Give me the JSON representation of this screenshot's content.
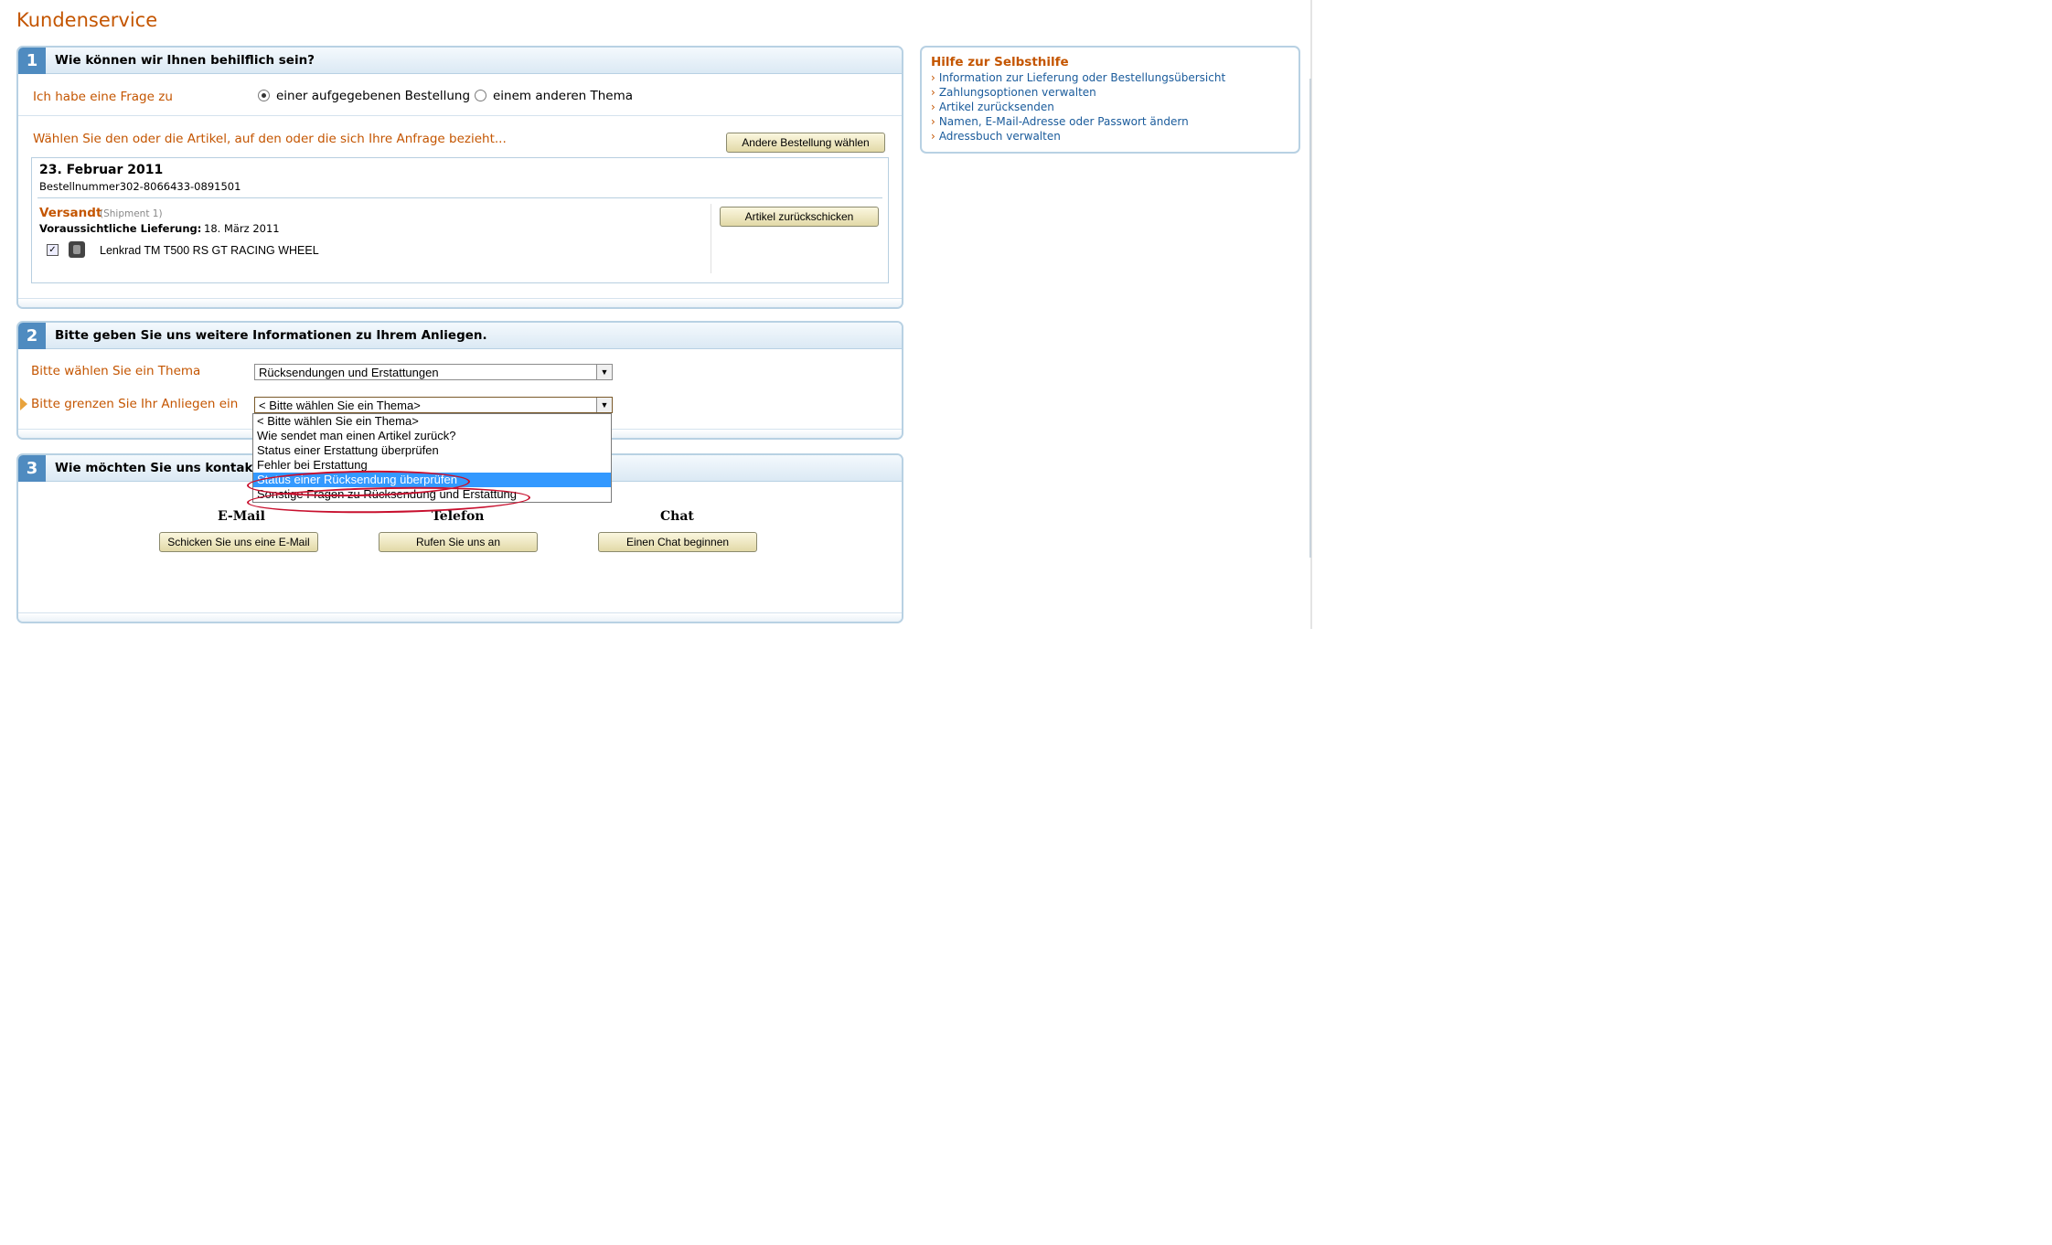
{
  "page_title": "Kundenservice",
  "section1": {
    "number": "1",
    "title": "Wie können wir Ihnen behilflich sein?",
    "question_label": "Ich habe eine Frage zu",
    "radio_order": "einer aufgegebenen Bestellung",
    "radio_other": "einem anderen Thema",
    "select_items_label": "Wählen Sie den oder die Artikel, auf den oder die sich Ihre Anfrage bezieht...",
    "other_order_button": "Andere Bestellung wählen",
    "order": {
      "date": "23. Februar 2011",
      "order_number": "Bestellnummer302-8066433-0891501",
      "shipped": "Versandt",
      "shipment": "(Shipment 1)",
      "delivery_label": "Voraussichtliche Lieferung:",
      "delivery_date": "18. März 2011",
      "item_name": "Lenkrad TM T500 RS GT RACING WHEEL",
      "return_button": "Artikel zurückschicken"
    }
  },
  "section2": {
    "number": "2",
    "title": "Bitte geben Sie uns weitere Informationen zu Ihrem Anliegen.",
    "topic_label": "Bitte wählen Sie ein Thema",
    "topic_value": "Rücksendungen und Erstattungen",
    "narrow_label": "Bitte grenzen Sie Ihr Anliegen ein",
    "narrow_value": "< Bitte wählen Sie ein Thema>",
    "options": [
      "< Bitte wählen Sie ein Thema>",
      "Wie sendet man einen Artikel zurück?",
      "Status einer Erstattung überprüfen",
      "Fehler bei Erstattung",
      "Status einer Rücksendung überprüfen",
      "Sonstige Fragen zu Rücksendung und Erstattung"
    ]
  },
  "section3": {
    "number": "3",
    "title": "Wie möchten Sie uns kontaktieren?",
    "email_title": "E-Mail",
    "email_button": "Schicken Sie uns eine E-Mail",
    "phone_title": "Telefon",
    "phone_button": "Rufen Sie uns an",
    "chat_title": "Chat",
    "chat_button": "Einen Chat beginnen"
  },
  "help": {
    "title": "Hilfe zur Selbsthilfe",
    "links": [
      "Information zur Lieferung oder Bestellungsübersicht",
      "Zahlungsoptionen verwalten",
      "Artikel zurücksenden",
      "Namen, E-Mail-Adresse oder Passwort ändern",
      "Adressbuch verwalten"
    ]
  },
  "colors": {
    "accent": "#c45500",
    "link": "#1a5b9b",
    "box_border": "#b8d1e3",
    "step_badge": "#4f8bc0",
    "highlight": "#3399ff",
    "annotation": "#c8102e"
  }
}
